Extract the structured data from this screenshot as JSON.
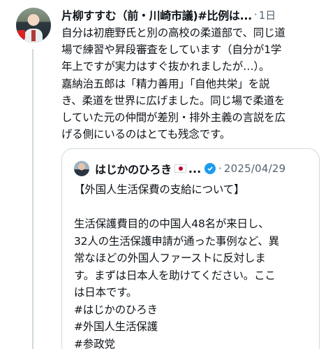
{
  "tweet": {
    "author": "片柳すすむ（前・川崎市議)#比例は...",
    "separator": "·",
    "time": "1日",
    "lines": [
      "自分は初鹿野氏と別の高校の柔道部で、同じ道",
      "場で練習や昇段審査をしています（自分が1学",
      "年上ですが実力はすぐ抜かれましたが…）。",
      "嘉納治五郎は「精力善用」「自他共栄」を説",
      "き、柔道を世界に広げました。同じ場で柔道を",
      "していた元の仲間が差別・排外主義の言説を広",
      "げる側にいるのはとても残念です。"
    ]
  },
  "quote": {
    "author": "はじかのひろき",
    "ellipsis": "...",
    "separator": "·",
    "date": "2025/04/29",
    "lines": [
      "【外国人生活保費の支給について】",
      "",
      "生活保護費目的の中国人48名が来日し、",
      "32人の生活保護申請が通った事例など、異",
      "常なほどの外国人ファーストに反対しま",
      "す。まずは日本人を助けてください。ここ",
      "は日本です。",
      "#はじかのひろき",
      "#外国人生活保護",
      "#参政党"
    ]
  },
  "icons": {
    "avatar": "profile-photo",
    "quote_avatar": "profile-photo",
    "flag": "japan-flag-emoji",
    "verified": "verified-badge-icon"
  },
  "colors": {
    "text": "#0f1419",
    "muted": "#536471",
    "border": "#cfd9de",
    "verified": "#1d9bf0"
  }
}
